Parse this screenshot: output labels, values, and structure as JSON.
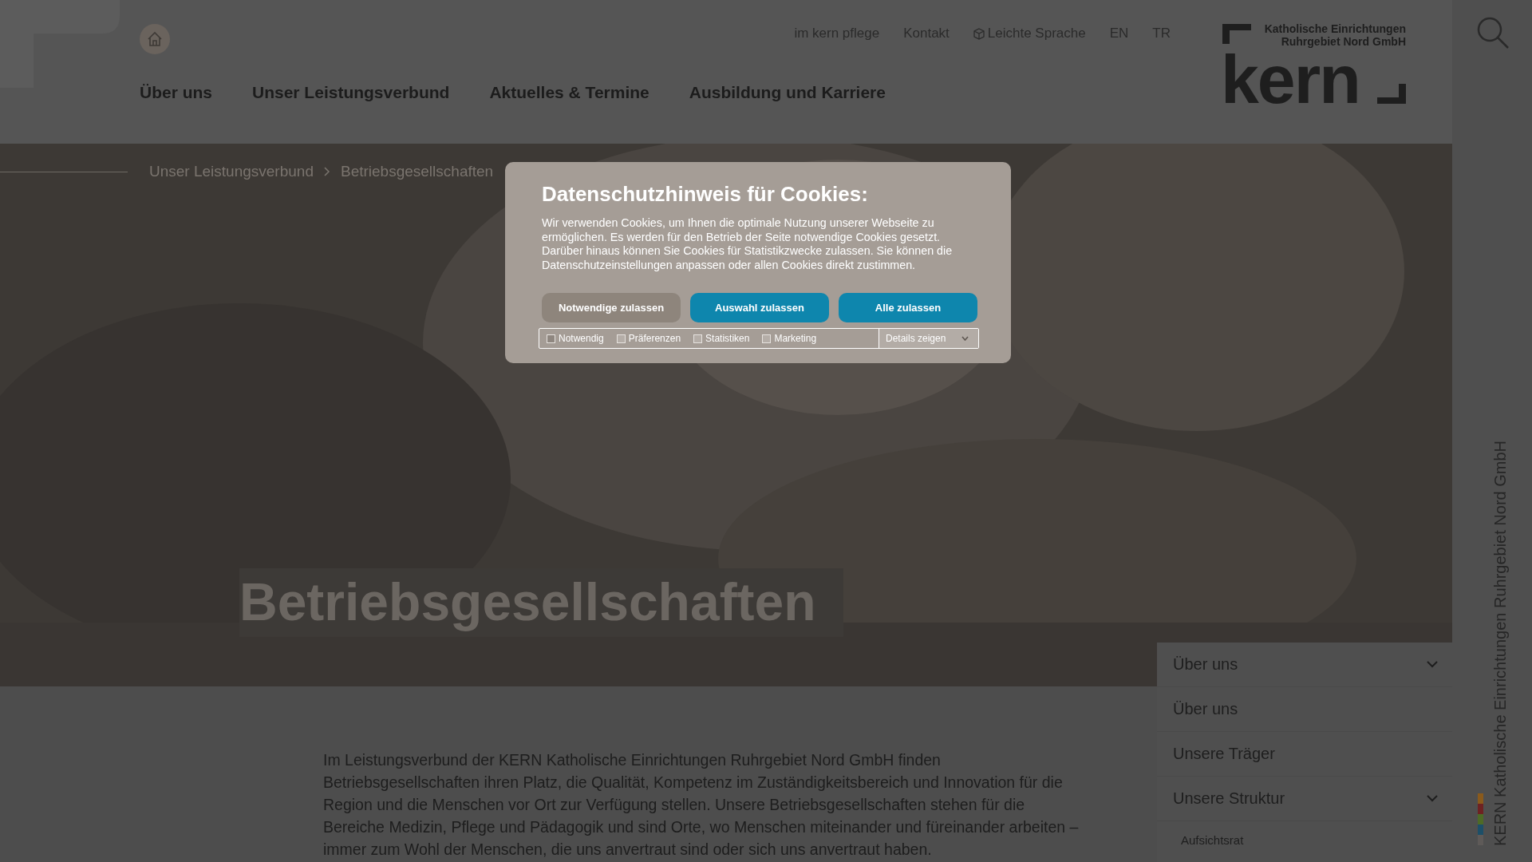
{
  "header": {
    "top_links": [
      {
        "label": "im kern pflege",
        "kind": "text"
      },
      {
        "label": "Kontakt",
        "kind": "text"
      },
      {
        "label": "Leichte Sprache",
        "kind": "icon"
      },
      {
        "label": "EN",
        "kind": "text"
      },
      {
        "label": "TR",
        "kind": "text"
      }
    ],
    "nav": [
      "Über uns",
      "Unser Leistungsverbund",
      "Aktuelles & Termine",
      "Ausbildung und Karriere"
    ],
    "logo": {
      "tagline": [
        "Katholische Einrichtungen",
        "Ruhrgebiet Nord GmbH"
      ],
      "wordmark": "kern"
    }
  },
  "breadcrumb": [
    "Unser Leistungsverbund",
    "Betriebsgesellschaften"
  ],
  "hero": {
    "kind": "picture",
    "title": "Betriebsgesellschaften"
  },
  "intro": "Im Leistungsverbund der KERN Katholische Einrichtungen Ruhrgebiet Nord GmbH finden Betriebsgesellschaften ihren Platz, die Qualität, Kompetenz im Zuständigkeitsbereich und Innovation für die Region und die Menschen vor Ort zur Verfügung stellen. Unsere Betriebsgesellschaften stehen für die Bereiche Medizin, Pflege und Pädagogik und sind Orte, wo Menschen miteinander und füreinander arbeiten – immer zum Wohl der Menschen, die uns anvertraut sind oder sich uns anvertraut haben.",
  "side_menu": [
    {
      "label": "Über uns",
      "kind": "section"
    },
    {
      "label": "Über uns",
      "kind": "link"
    },
    {
      "label": "Unsere Träger",
      "kind": "link"
    },
    {
      "label": "Unsere Struktur",
      "kind": "section"
    },
    {
      "label": "Aufsichtsrat",
      "kind": "sublink"
    }
  ],
  "side_strip": {
    "label": "KERN Katholische Einrichtungen Ruhrgebiet Nord GmbH",
    "stripes": [
      {
        "color": "#8a5a1c"
      },
      {
        "color": "#6e2222"
      },
      {
        "color": "#4e6a26"
      },
      {
        "color": "#1d4f68"
      },
      {
        "color": "#5e5a58"
      }
    ]
  },
  "cookie_dialog": {
    "title": "Datenschutzhinweis für Cookies:",
    "text": "Wir verwenden Cookies, um Ihnen die optimale Nutzung unserer Webseite zu ermöglichen. Es werden für den Betrieb der Seite notwendige Cookies gesetzt. Darüber hinaus können Sie Cookies für Statistikzwecke zulassen. Sie können die Datenschutzeinstellungen anpassen oder allen Cookies direkt zustimmen.",
    "buttons": [
      {
        "label": "Notwendige zulassen",
        "kind": "secondary"
      },
      {
        "label": "Auswahl zulassen",
        "kind": "primary"
      },
      {
        "label": "Alle zulassen",
        "kind": "primary"
      }
    ],
    "options": [
      {
        "label": "Notwendig",
        "checked": false,
        "disabled": true
      },
      {
        "label": "Präferenzen",
        "checked": false,
        "disabled": false
      },
      {
        "label": "Statistiken",
        "checked": false,
        "disabled": false
      },
      {
        "label": "Marketing",
        "checked": false,
        "disabled": false
      }
    ],
    "details": {
      "label": "Details zeigen",
      "expanded": false
    }
  }
}
